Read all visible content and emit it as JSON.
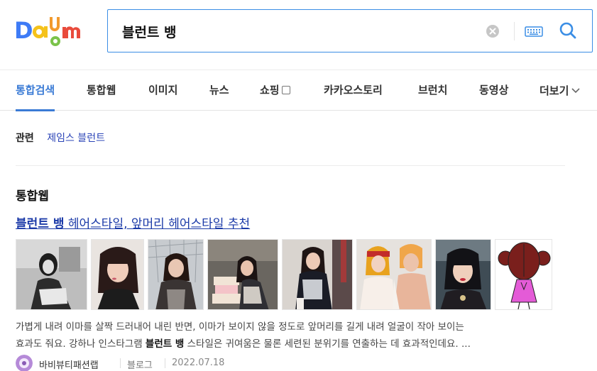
{
  "logo": {
    "text": "Daum"
  },
  "search": {
    "query": "블런트 뱅",
    "clear_icon": "clear-circle-icon",
    "keyboard_icon": "keyboard-icon",
    "search_icon": "search-icon",
    "accent": "#3b8ee5"
  },
  "tabs": [
    {
      "label": "통합검색",
      "active": true
    },
    {
      "label": "통합웹"
    },
    {
      "label": "이미지"
    },
    {
      "label": "뉴스"
    },
    {
      "label": "쇼핑"
    },
    {
      "label": "카카오스토리"
    },
    {
      "label": "브런치"
    },
    {
      "label": "동영상"
    },
    {
      "label": "더보기"
    }
  ],
  "related": {
    "label": "관련",
    "link": "제임스 블런트"
  },
  "section": {
    "title": "통합웹"
  },
  "result": {
    "title_bold": "블런트 뱅",
    "title_rest": " 헤어스타일, 앞머리 헤어스타일 추천",
    "snippet_line1": "가볍게 내려 이마를 살짝 드러내어 내린 반면, 이마가 보이지 않을 정도로 앞머리를 길게 내려 얼굴이 작아 보이는",
    "snippet_line2_a": "효과도 줘요. 강하나 인스타그램 ",
    "snippet_line2_bold": "블런트 뱅",
    "snippet_line2_b": " 스타일은 귀여움은 물론 세련된 분위기를 연출하는 데 효과적인데요. ...",
    "blogger": "바비뷰티패션랩",
    "source": "블로그",
    "date": "2022.07.18"
  }
}
